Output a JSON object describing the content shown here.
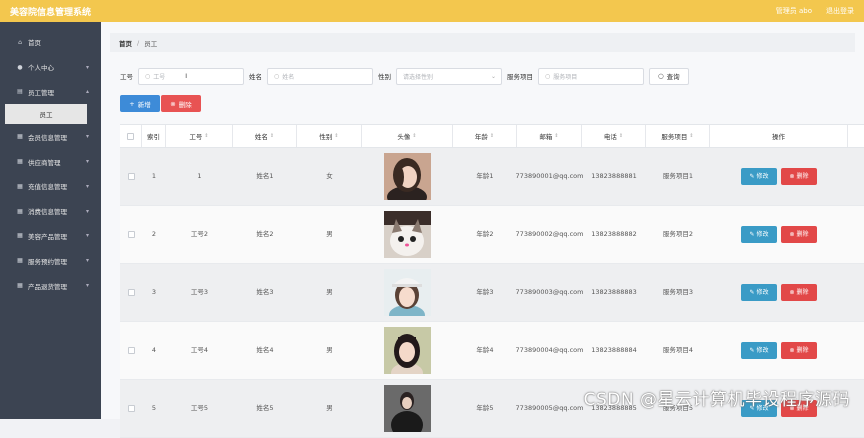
{
  "header": {
    "app_title": "美容院信息管理系统",
    "user": "管理员 abo",
    "logout": "退出登录"
  },
  "sidebar": {
    "items": [
      {
        "icon": "home-icon",
        "glyph": "⌂",
        "label": "首页"
      },
      {
        "icon": "user-icon",
        "glyph": "●",
        "label": "个人中心"
      },
      {
        "icon": "staff-icon",
        "glyph": "▤",
        "label": "员工管理"
      },
      {
        "icon": "grid-icon",
        "glyph": "▦",
        "label": "会员信息管理"
      },
      {
        "icon": "grid-icon",
        "glyph": "▦",
        "label": "供应商管理"
      },
      {
        "icon": "grid-icon",
        "glyph": "▦",
        "label": "充值信息管理"
      },
      {
        "icon": "grid-icon",
        "glyph": "▦",
        "label": "消费信息管理"
      },
      {
        "icon": "grid-icon",
        "glyph": "▦",
        "label": "美容产品管理"
      },
      {
        "icon": "grid-icon",
        "glyph": "▦",
        "label": "服务预约管理"
      },
      {
        "icon": "grid-icon",
        "glyph": "▦",
        "label": "产品退货管理"
      }
    ],
    "sub_item": "员工"
  },
  "breadcrumb": {
    "home": "首页",
    "sep": "/",
    "current": "员工"
  },
  "search": {
    "gonghao_label": "工号",
    "gonghao_placeholder": "工号",
    "name_label": "姓名",
    "name_placeholder": "姓名",
    "gender_label": "性别",
    "gender_placeholder": "请选择性别",
    "service_label": "服务项目",
    "service_placeholder": "服务项目",
    "query_button": "查询"
  },
  "actions": {
    "add": "新增",
    "delete": "删除"
  },
  "table": {
    "headers": [
      "索引",
      "工号",
      "姓名",
      "性别",
      "头像",
      "年龄",
      "邮箱",
      "电话",
      "服务项目",
      "操作"
    ],
    "edit_label": "修改",
    "delete_label": "删除",
    "rows": [
      {
        "idx": "1",
        "gonghao": "1",
        "name": "姓名1",
        "gender": "女",
        "age": "年龄1",
        "email": "773890001@qq.com",
        "phone": "13823888881",
        "service": "服务项目1"
      },
      {
        "idx": "2",
        "gonghao": "工号2",
        "name": "姓名2",
        "gender": "男",
        "age": "年龄2",
        "email": "773890002@qq.com",
        "phone": "13823888882",
        "service": "服务项目2"
      },
      {
        "idx": "3",
        "gonghao": "工号3",
        "name": "姓名3",
        "gender": "男",
        "age": "年龄3",
        "email": "773890003@qq.com",
        "phone": "13823888883",
        "service": "服务项目3"
      },
      {
        "idx": "4",
        "gonghao": "工号4",
        "name": "姓名4",
        "gender": "男",
        "age": "年龄4",
        "email": "773890004@qq.com",
        "phone": "13823888884",
        "service": "服务项目4"
      },
      {
        "idx": "5",
        "gonghao": "工号5",
        "name": "姓名5",
        "gender": "男",
        "age": "年龄5",
        "email": "773890005@qq.com",
        "phone": "13823888885",
        "service": "服务项目5"
      }
    ]
  },
  "watermark": "CSDN @星云计算机毕设程序源码"
}
